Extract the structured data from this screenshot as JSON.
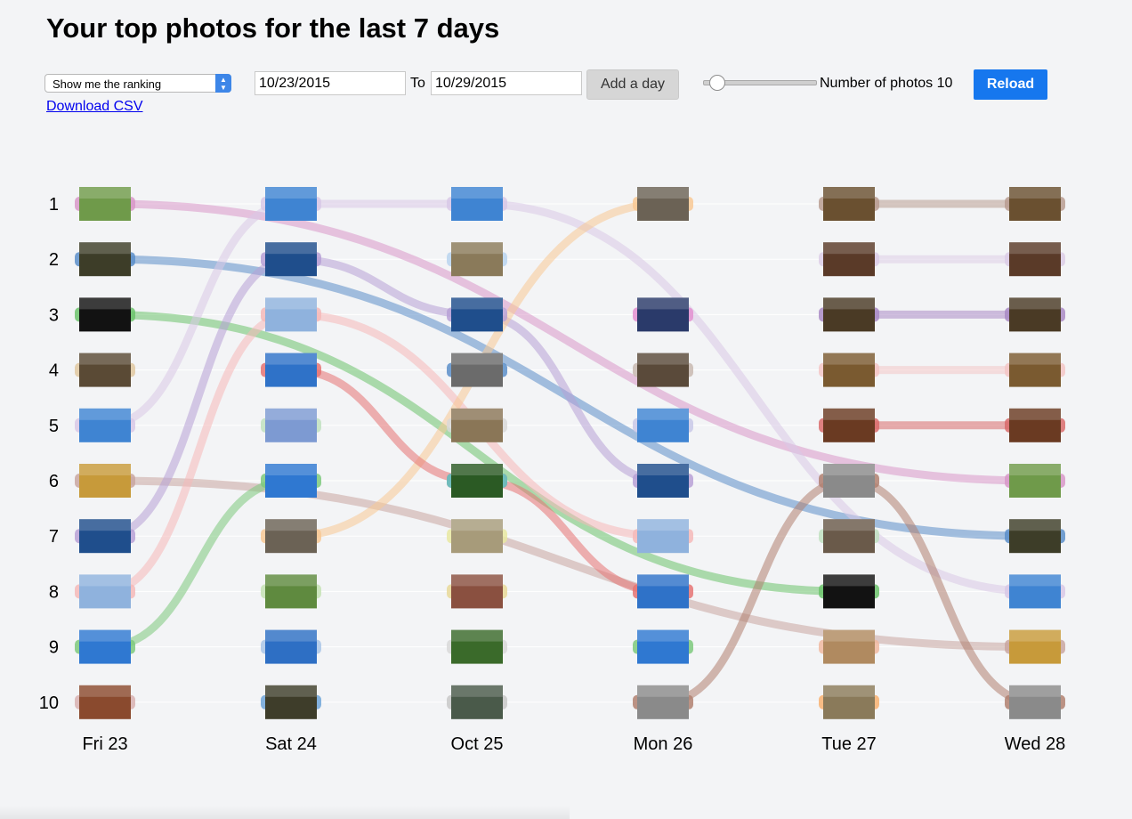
{
  "title": "Your top photos for the last 7 days",
  "controls": {
    "mode_select": "Show me the ranking",
    "download_link": "Download CSV",
    "date_from": "10/23/2015",
    "to_label": "To",
    "date_to": "10/29/2015",
    "add_day_label": "Add a day",
    "num_photos_label": "Number of photos 10",
    "num_photos_value": 10,
    "reload_label": "Reload"
  },
  "ranks": [
    "1",
    "2",
    "3",
    "4",
    "5",
    "6",
    "7",
    "8",
    "9",
    "10"
  ],
  "days": [
    "Fri 23",
    "Sat 24",
    "Oct 25",
    "Mon 26",
    "Tue 27",
    "Wed 28"
  ],
  "photos": [
    {
      "icon": "succulent-photo-icon",
      "fill": "#6f9a4a",
      "accent": "#d898c8",
      "pos": [
        1,
        null,
        null,
        null,
        null,
        6
      ]
    },
    {
      "icon": "forest-photo-icon",
      "fill": "#3d3d28",
      "accent": "#5b8ec9",
      "pos": [
        2,
        null,
        null,
        null,
        null,
        7
      ]
    },
    {
      "icon": "cave-silhouette-photo-icon",
      "fill": "#121212",
      "accent": "#6cc36c",
      "pos": [
        3,
        null,
        null,
        null,
        8,
        null
      ]
    },
    {
      "icon": "sunset-clouds-photo-icon",
      "fill": "#5a4a35",
      "accent": "#e0c8a0",
      "pos": [
        4,
        null,
        null,
        null,
        null,
        null
      ]
    },
    {
      "icon": "plane-sky-photo-icon",
      "fill": "#3f84d2",
      "accent": "#d8c8e6",
      "pos": [
        5,
        1,
        1,
        null,
        null,
        8
      ]
    },
    {
      "icon": "food-plate-photo-icon",
      "fill": "#c79a3a",
      "accent": "#c9a6a0",
      "pos": [
        6,
        null,
        null,
        null,
        null,
        9
      ]
    },
    {
      "icon": "plane-contrail-photo-icon",
      "fill": "#1f4e8c",
      "accent": "#b7a0d6",
      "pos": [
        7,
        2,
        3,
        6,
        null,
        null
      ]
    },
    {
      "icon": "bird-photo-icon",
      "fill": "#8fb2dd",
      "accent": "#f5b8b8",
      "pos": [
        8,
        3,
        null,
        7,
        null,
        null
      ]
    },
    {
      "icon": "plane-photo-icon",
      "fill": "#2f78d1",
      "accent": "#7cc97c",
      "pos": [
        9,
        6,
        null,
        null,
        null,
        null
      ]
    },
    {
      "icon": "food-platter-photo-icon",
      "fill": "#8a4a2e",
      "accent": "#d8b0b0",
      "pos": [
        10,
        null,
        null,
        null,
        null,
        null
      ]
    },
    {
      "icon": "forest-path-photo-icon",
      "fill": "#3e3d2a",
      "accent": "#6ea5d8",
      "pos": [
        null,
        10,
        null,
        null,
        null,
        null
      ]
    },
    {
      "icon": "pier-sunset-photo-icon",
      "fill": "#6b6255",
      "accent": "#f8c894",
      "pos": [
        null,
        7,
        null,
        1,
        null,
        null
      ]
    },
    {
      "icon": "sheep-field-photo-icon",
      "fill": "#5f8a3f",
      "accent": "#c4e2b4",
      "pos": [
        null,
        8,
        null,
        null,
        null,
        null
      ]
    },
    {
      "icon": "sky-contrail-photo-icon",
      "fill": "#2e6fc4",
      "accent": "#a9c6e8",
      "pos": [
        null,
        9,
        null,
        null,
        null,
        null
      ]
    },
    {
      "icon": "bird-wing-photo-icon",
      "fill": "#2f72c8",
      "accent": "#e57373",
      "pos": [
        null,
        4,
        6,
        8,
        null,
        null
      ]
    },
    {
      "icon": "blue-figure-photo-icon",
      "fill": "#7d9ad2",
      "accent": "#bfe0bf",
      "pos": [
        null,
        5,
        null,
        null,
        null,
        null
      ]
    },
    {
      "icon": "road-sunrise-photo-icon",
      "fill": "#8a7a5a",
      "accent": "#b9d3ee",
      "pos": [
        null,
        null,
        2,
        null,
        null,
        null
      ]
    },
    {
      "icon": "dog-photo-icon",
      "fill": "#6b6b6b",
      "accent": "#5b8ec9",
      "pos": [
        null,
        null,
        4,
        null,
        null,
        null
      ]
    },
    {
      "icon": "rope-photo-icon",
      "fill": "#8a7657",
      "accent": "#d8d8d8",
      "pos": [
        null,
        null,
        5,
        null,
        null,
        null
      ]
    },
    {
      "icon": "flower-red-photo-icon",
      "fill": "#2b5a24",
      "accent": "#5bc6c6",
      "pos": [
        null,
        null,
        6,
        null,
        null,
        null
      ]
    },
    {
      "icon": "garden-path-photo-icon",
      "fill": "#a79b7a",
      "accent": "#e8e8a0",
      "pos": [
        null,
        null,
        7,
        null,
        null,
        null
      ]
    },
    {
      "icon": "bus-interior-photo-icon",
      "fill": "#8a5040",
      "accent": "#e8d898",
      "pos": [
        null,
        null,
        8,
        null,
        null,
        null
      ]
    },
    {
      "icon": "berries-photo-icon",
      "fill": "#3a6a2a",
      "accent": "#d8d8d8",
      "pos": [
        null,
        null,
        9,
        null,
        null,
        null
      ]
    },
    {
      "icon": "tree-branches-photo-icon",
      "fill": "#4a5a4a",
      "accent": "#c8c8c8",
      "pos": [
        null,
        null,
        10,
        null,
        null,
        null
      ]
    },
    {
      "icon": "ferris-wheel-photo-icon",
      "fill": "#2a3a6a",
      "accent": "#e38fd0",
      "pos": [
        null,
        null,
        null,
        3,
        null,
        null
      ]
    },
    {
      "icon": "white-flowers-photo-icon",
      "fill": "#5a4a3a",
      "accent": "#c8b8b0",
      "pos": [
        null,
        null,
        null,
        4,
        null,
        null
      ]
    },
    {
      "icon": "plane-blue-photo-icon",
      "fill": "#3f84d2",
      "accent": "#c8c8e8",
      "pos": [
        null,
        null,
        null,
        5,
        null,
        null
      ]
    },
    {
      "icon": "plane-flying-photo-icon",
      "fill": "#2f78d1",
      "accent": "#7cc97c",
      "pos": [
        null,
        null,
        null,
        9,
        null,
        null
      ]
    },
    {
      "icon": "rainy-window-photo-icon",
      "fill": "#8a8a8a",
      "accent": "#b08070",
      "pos": [
        null,
        null,
        null,
        10,
        6,
        10
      ]
    },
    {
      "icon": "hall-a-photo-icon",
      "fill": "#6a5030",
      "accent": "#b89c90",
      "pos": [
        null,
        null,
        null,
        null,
        1,
        1
      ]
    },
    {
      "icon": "hall-b-photo-icon",
      "fill": "#5a3a28",
      "accent": "#dccde6",
      "pos": [
        null,
        null,
        null,
        null,
        2,
        2
      ]
    },
    {
      "icon": "hall-c-photo-icon",
      "fill": "#4a3a25",
      "accent": "#a98ac4",
      "pos": [
        null,
        null,
        null,
        null,
        3,
        3
      ]
    },
    {
      "icon": "hall-d-photo-icon",
      "fill": "#7a5a30",
      "accent": "#f3c6c6",
      "pos": [
        null,
        null,
        null,
        null,
        4,
        4
      ]
    },
    {
      "icon": "hall-e-photo-icon",
      "fill": "#6a3a22",
      "accent": "#d96b6b",
      "pos": [
        null,
        null,
        null,
        null,
        5,
        5
      ]
    },
    {
      "icon": "rocks-photo-icon",
      "fill": "#6a5a4a",
      "accent": "#bfe0bf",
      "pos": [
        null,
        null,
        null,
        null,
        7,
        null
      ]
    },
    {
      "icon": "tea-cup-photo-icon",
      "fill": "#b08a60",
      "accent": "#f0b8a0",
      "pos": [
        null,
        null,
        null,
        null,
        9,
        null
      ]
    },
    {
      "icon": "butterfly-photo-icon",
      "fill": "#8a7a5a",
      "accent": "#f8b070",
      "pos": [
        null,
        null,
        null,
        null,
        10,
        null
      ]
    }
  ]
}
